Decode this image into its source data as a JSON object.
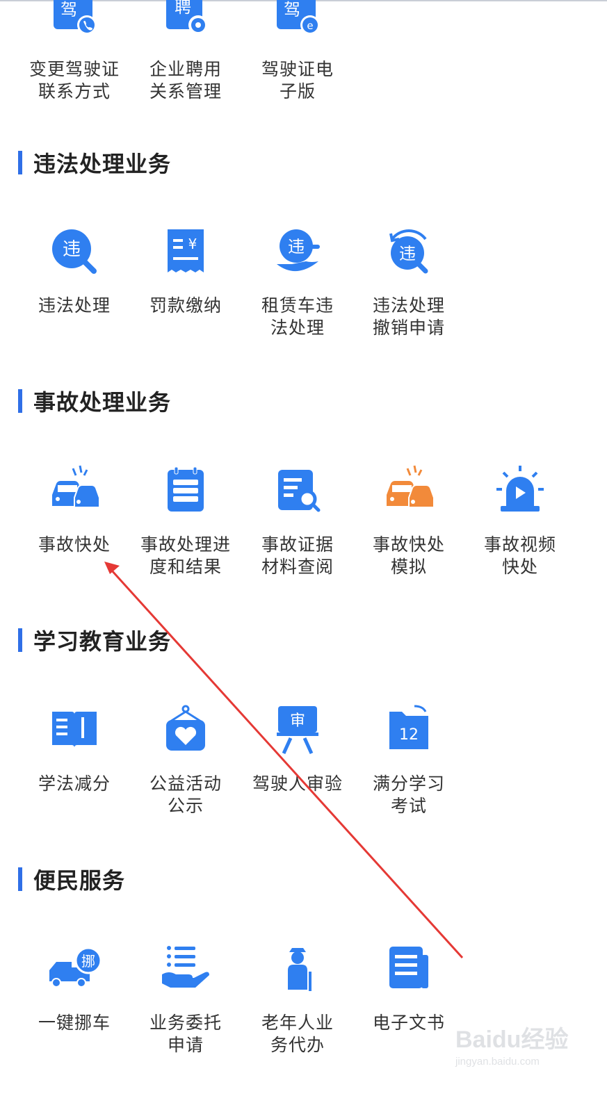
{
  "colors": {
    "accent": "#2f6fe7",
    "icon_blue": "#2f7ff0",
    "icon_orange": "#f28a3a",
    "arrow": "#e53935"
  },
  "top_row": [
    {
      "label": "变更驾驶证\n联系方式",
      "icon": "driving-license-phone-icon",
      "glyph": "驾"
    },
    {
      "label": "企业聘用\n关系管理",
      "icon": "employment-gear-icon",
      "glyph": "聘"
    },
    {
      "label": "驾驶证电\n子版",
      "icon": "electronic-license-icon",
      "glyph": "驾"
    }
  ],
  "sections": [
    {
      "title": "违法处理业务",
      "items": [
        {
          "label": "违法处理",
          "icon": "violation-search-icon",
          "glyph": "违"
        },
        {
          "label": "罚款缴纳",
          "icon": "fine-receipt-icon",
          "glyph": "¥"
        },
        {
          "label": "租赁车违\n法处理",
          "icon": "rental-violation-icon",
          "glyph": "违"
        },
        {
          "label": "违法处理\n撤销申请",
          "icon": "violation-revoke-icon",
          "glyph": "违"
        }
      ]
    },
    {
      "title": "事故处理业务",
      "items": [
        {
          "label": "事故快处",
          "icon": "car-collision-icon"
        },
        {
          "label": "事故处理进\n度和结果",
          "icon": "clipboard-progress-icon"
        },
        {
          "label": "事故证据\n材料查阅",
          "icon": "document-search-icon"
        },
        {
          "label": "事故快处\n模拟",
          "icon": "car-collision-orange-icon"
        },
        {
          "label": "事故视频\n快处",
          "icon": "siren-video-icon"
        }
      ]
    },
    {
      "title": "学习教育业务",
      "items": [
        {
          "label": "学法减分",
          "icon": "open-book-icon"
        },
        {
          "label": "公益活动\n公示",
          "icon": "charity-heart-icon"
        },
        {
          "label": "驾驶人审验",
          "icon": "review-board-icon",
          "glyph": "审"
        },
        {
          "label": "满分学习\n考试",
          "icon": "score-folder-icon",
          "glyph": "12"
        }
      ]
    },
    {
      "title": "便民服务",
      "items": [
        {
          "label": "一键挪车",
          "icon": "move-car-truck-icon",
          "glyph": "挪"
        },
        {
          "label": "业务委托\n申请",
          "icon": "delegate-hand-icon"
        },
        {
          "label": "老年人业\n务代办",
          "icon": "elderly-person-icon"
        },
        {
          "label": "电子文书",
          "icon": "e-document-icon"
        }
      ]
    }
  ],
  "watermark": {
    "main": "Baidu经验",
    "sub": "jingyan.baidu.com"
  }
}
